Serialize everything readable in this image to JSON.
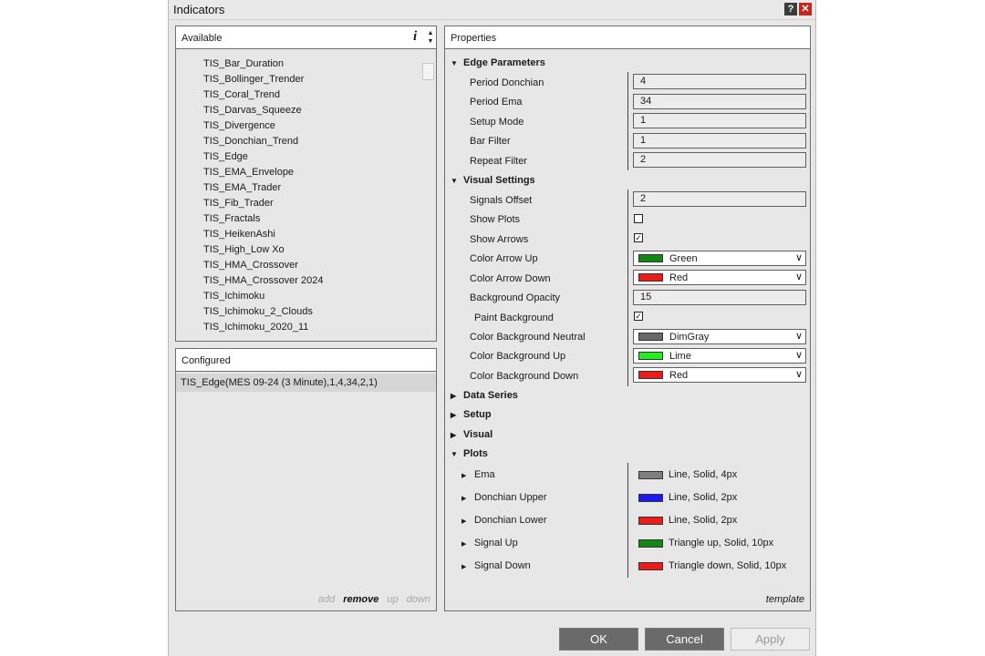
{
  "window": {
    "title": "Indicators",
    "help_label": "?",
    "close_label": "✕"
  },
  "available": {
    "header": "Available",
    "info_label": "i",
    "items": [
      "TIS_Bar_Duration",
      "TIS_Bollinger_Trender",
      "TIS_Coral_Trend",
      "TIS_Darvas_Squeeze",
      "TIS_Divergence",
      "TIS_Donchian_Trend",
      "TIS_Edge",
      "TIS_EMA_Envelope",
      "TIS_EMA_Trader",
      "TIS_Fib_Trader",
      "TIS_Fractals",
      "TIS_HeikenAshi",
      "TIS_High_Low Xo",
      "TIS_HMA_Crossover",
      "TIS_HMA_Crossover 2024",
      "TIS_Ichimoku",
      "TIS_Ichimoku_2_Clouds",
      "TIS_Ichimoku_2020_11"
    ]
  },
  "configured": {
    "header": "Configured",
    "items": [
      "TIS_Edge(MES 09-24 (3 Minute),1,4,34,2,1)"
    ],
    "actions": {
      "add": "add",
      "remove": "remove",
      "up": "up",
      "down": "down"
    }
  },
  "properties": {
    "header": "Properties",
    "edge": {
      "title": "Edge Parameters",
      "period_donchian": {
        "label": "Period Donchian",
        "value": "4"
      },
      "period_ema": {
        "label": "Period Ema",
        "value": "34"
      },
      "setup_mode": {
        "label": "Setup Mode",
        "value": "1"
      },
      "bar_filter": {
        "label": "Bar Filter",
        "value": "1"
      },
      "repeat_filter": {
        "label": "Repeat Filter",
        "value": "2"
      }
    },
    "visual_settings": {
      "title": "Visual Settings",
      "signals_offset": {
        "label": "Signals Offset",
        "value": "2"
      },
      "show_plots": {
        "label": "Show Plots",
        "checked": false
      },
      "show_arrows": {
        "label": "Show Arrows",
        "checked": true
      },
      "color_arrow_up": {
        "label": "Color Arrow Up",
        "value": "Green",
        "color": "#138713"
      },
      "color_arrow_down": {
        "label": "Color Arrow Down",
        "value": "Red",
        "color": "#ee1b1b"
      },
      "background_opacity": {
        "label": "Background Opacity",
        "value": "15"
      },
      "paint_background": {
        "label": "Paint Background",
        "checked": true
      },
      "color_bg_neutral": {
        "label": "Color Background Neutral",
        "value": "DimGray",
        "color": "#696969"
      },
      "color_bg_up": {
        "label": "Color Background Up",
        "value": "Lime",
        "color": "#22ee22"
      },
      "color_bg_down": {
        "label": "Color Background Down",
        "value": "Red",
        "color": "#ee1b1b"
      }
    },
    "sections_collapsed": [
      "Data Series",
      "Setup",
      "Visual"
    ],
    "plots": {
      "title": "Plots",
      "items": [
        {
          "label": "Ema",
          "value": "Line, Solid, 4px",
          "color": "#7f7f7f"
        },
        {
          "label": "Donchian Upper",
          "value": "Line, Solid, 2px",
          "color": "#1a1aee"
        },
        {
          "label": "Donchian Lower",
          "value": "Line, Solid, 2px",
          "color": "#ee1b1b"
        },
        {
          "label": "Signal Up",
          "value": "Triangle up, Solid, 10px",
          "color": "#138713"
        },
        {
          "label": "Signal Down",
          "value": "Triangle down, Solid, 10px",
          "color": "#ee1b1b"
        }
      ]
    },
    "template_label": "template"
  },
  "buttons": {
    "ok": "OK",
    "cancel": "Cancel",
    "apply": "Apply"
  }
}
